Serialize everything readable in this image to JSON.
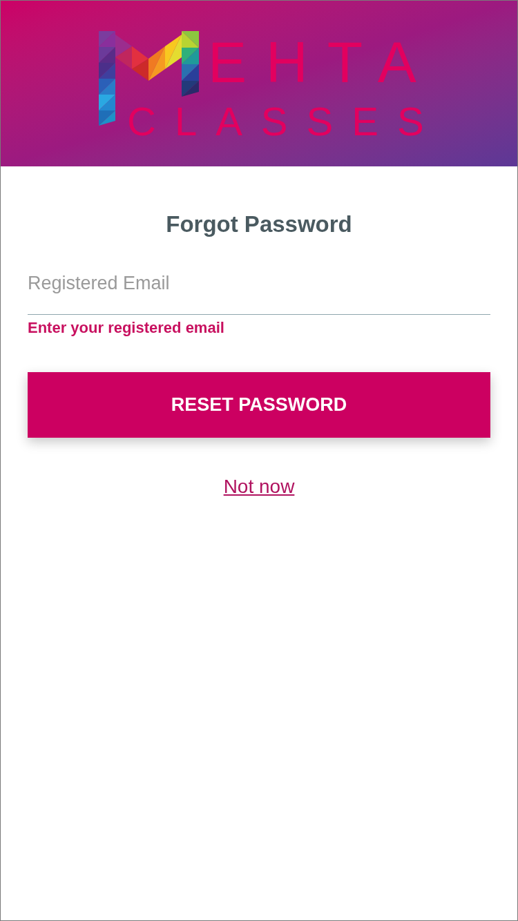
{
  "header": {
    "logo": {
      "line_1": "EHTA",
      "line_2": "CLASSES"
    }
  },
  "title": "Forgot Password",
  "email_field": {
    "placeholder": "Registered Email"
  },
  "error_message": "Enter your registered email",
  "reset_button": {
    "label": "RESET PASSWORD"
  },
  "not_now_link": {
    "label": "Not now"
  }
}
